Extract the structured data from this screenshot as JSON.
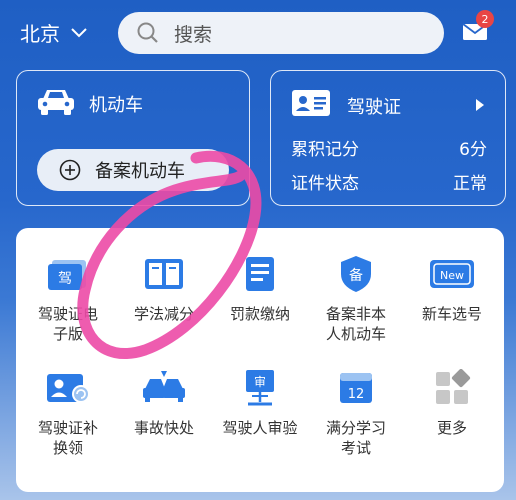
{
  "header": {
    "city": "北京",
    "search_placeholder": "搜索",
    "mail_badge": "2"
  },
  "vehicle_card": {
    "title": "机动车",
    "register_button": "备案机动车"
  },
  "license_card": {
    "title": "驾驶证",
    "points_label": "累积记分",
    "points_value": "6分",
    "status_label": "证件状态",
    "status_value": "正常"
  },
  "services": [
    {
      "line1": "驾驶证电",
      "line2": "子版",
      "icon": "e-license-icon"
    },
    {
      "line1": "学法减分",
      "line2": "",
      "icon": "book-icon"
    },
    {
      "line1": "罚款缴纳",
      "line2": "",
      "icon": "fine-icon"
    },
    {
      "line1": "备案非本",
      "line2": "人机动车",
      "icon": "shield-icon"
    },
    {
      "line1": "新车选号",
      "line2": "",
      "icon": "new-plate-icon"
    },
    {
      "line1": "驾驶证补",
      "line2": "换领",
      "icon": "license-renew-icon"
    },
    {
      "line1": "事故快处",
      "line2": "",
      "icon": "accident-icon"
    },
    {
      "line1": "驾驶人审验",
      "line2": "",
      "icon": "driver-review-icon"
    },
    {
      "line1": "满分学习",
      "line2": "考试",
      "icon": "exam-icon"
    },
    {
      "line1": "更多",
      "line2": "",
      "icon": "more-icon"
    }
  ],
  "icon_glyphs": {
    "e_license_text": "驾",
    "shield_text": "备",
    "new_plate_text": "New",
    "review_text": "审",
    "exam_text": "12"
  },
  "colors": {
    "accent": "#2c7be5",
    "scribble": "#ec4aa6"
  }
}
